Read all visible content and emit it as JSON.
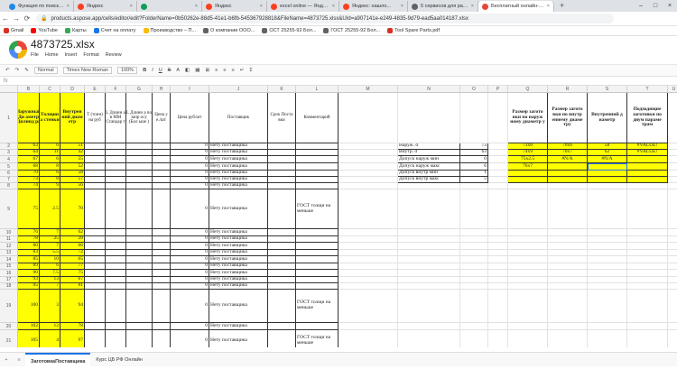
{
  "browser": {
    "tabs": [
      {
        "title": "Функция по поиску ближайш...",
        "color": "#1e88e5"
      },
      {
        "title": "Яндекс",
        "color": "#fc3f1d"
      },
      {
        "title": "",
        "color": "#0f9d58"
      },
      {
        "title": "Яндекс",
        "color": "#fc3f1d"
      },
      {
        "title": "excel online — Яндекс: нашло...",
        "color": "#fc3f1d"
      },
      {
        "title": "Яндекс: нашло...",
        "color": "#fc3f1d"
      },
      {
        "title": "5 сервисов для работы с табли...",
        "color": "#5f6368"
      },
      {
        "title": "Бесплатный онлайн-редактор ...",
        "color": "#e8463b"
      }
    ],
    "close_glyph": "×",
    "new_tab_glyph": "+",
    "window_controls": [
      "–",
      "□",
      "×"
    ],
    "nav": [
      "←",
      "→",
      "⟳"
    ],
    "url": "products.aspose.app/cells/editor/edit?FolderName=0b50262e-88d5-41e1-b6fb-545367928818&FileName=4873725.xlsx&UId=a907141e-e249-4835-9d79-ead5aa014187.xlsx",
    "lock_glyph": "🔒",
    "bookmarks": [
      {
        "label": "Gmail",
        "color": "#d93025"
      },
      {
        "label": "YouTube",
        "color": "#ff0000"
      },
      {
        "label": "Карты",
        "color": "#34a853"
      },
      {
        "label": "Счет на оплату",
        "color": "#1a73e8"
      },
      {
        "label": "Производство – П...",
        "color": "#fbbc04"
      },
      {
        "label": "О компании ООО...",
        "color": "#5f6368"
      },
      {
        "label": "ОСТ 25255-92 Бол...",
        "color": "#5f6368"
      },
      {
        "label": "ГОСТ 25255-92 Бол...",
        "color": "#5f6368"
      },
      {
        "label": "Tool Spare Parts.pdf",
        "color": "#d93025"
      }
    ]
  },
  "app": {
    "file_name": "4873725.xlsx",
    "menus": [
      "File",
      "Home",
      "Insert",
      "Format",
      "Review"
    ],
    "toolbar": {
      "style": "Normal",
      "font": "Times New Roman",
      "zoom": "100%"
    }
  },
  "sheet": {
    "columns": [
      "B",
      "C",
      "D",
      "E",
      "F",
      "G",
      "H",
      "I",
      "J",
      "K",
      "L",
      "M",
      "N",
      "O",
      "P",
      "Q",
      "R",
      "S",
      "T",
      "U"
    ],
    "headers": {
      "B": "Наружный Ди аметр Цилинд ра",
      "C": "Толщин а стенки",
      "D": "Внутрен ний диам етр",
      "E": "Т (тонн) на руб",
      "F": "L Длинн а в ММ Стандар т",
      "G": "L Длинн а по запр осу (Бол ьше )",
      "H": "Цена у е./шт",
      "I": "Цена руб/шт",
      "J": "Поставщик",
      "K": "Срок Поста вки",
      "L": "Комментарий",
      "Q": "Размер загото вки по наруж ному диаметр у",
      "R": "Размер загото вки по внутр еннему диаме тру",
      "S": "Внутренний д иаметр",
      "T": "Подходящие заготовки по двум параме трам"
    },
    "rows": [
      {
        "n": "1"
      },
      {
        "n": "2",
        "B": "63",
        "C": "6",
        "D": "51",
        "I": "0",
        "J": "Нету поставщика"
      },
      {
        "n": "3",
        "B": "64",
        "C": "11",
        "D": "42",
        "I": "0",
        "J": "Нету поставщика"
      },
      {
        "n": "4",
        "B": "67",
        "C": "6",
        "D": "55",
        "I": "0",
        "J": "Нету поставщика"
      },
      {
        "n": "5",
        "B": "68",
        "C": "8",
        "D": "52",
        "I": "0",
        "J": "Нету поставщика"
      },
      {
        "n": "6",
        "B": "70",
        "C": "6",
        "D": "58",
        "I": "0",
        "J": "Нету поставщика"
      },
      {
        "n": "7",
        "B": "73",
        "C": "8",
        "D": "57",
        "I": "0",
        "J": "Нету поставщика"
      },
      {
        "n": "8",
        "B": "74",
        "C": "9",
        "D": "56",
        "I": "0",
        "J": "Нету поставщика"
      },
      {
        "n": "9",
        "B": "75",
        "C": "2.5",
        "D": "70",
        "I": "0",
        "J": "Нету поставщика",
        "L": "ГОСТ толщи на меньше"
      },
      {
        "n": "10",
        "B": "76",
        "C": "7",
        "D": "62",
        "I": "0",
        "J": "Нету поставщика"
      },
      {
        "n": "11",
        "B": "78",
        "C": "25",
        "D": "28",
        "I": "0",
        "J": "Нету поставщика"
      },
      {
        "n": "12",
        "B": "80",
        "C": "7",
        "D": "66",
        "I": "0",
        "J": "Нету поставщика"
      },
      {
        "n": "13",
        "B": "83",
        "C": "5.5",
        "D": "72",
        "I": "0",
        "J": "Нету поставщика"
      },
      {
        "n": "14",
        "B": "85",
        "C": "10",
        "D": "65",
        "I": "0",
        "J": "Нету поставщика"
      },
      {
        "n": "15",
        "B": "89",
        "C": "6",
        "D": "77",
        "I": "0",
        "J": "Нету поставщика"
      },
      {
        "n": "16",
        "B": "90",
        "C": "7.5",
        "D": "75",
        "I": "0",
        "J": "Нету поставщика"
      },
      {
        "n": "17",
        "B": "93",
        "C": "13",
        "D": "67",
        "I": "0",
        "J": "Нету поставщика"
      },
      {
        "n": "18",
        "B": "95",
        "C": "7",
        "D": "81",
        "I": "0",
        "J": "Нету поставщика"
      },
      {
        "n": "19",
        "B": "100",
        "C": "3",
        "D": "94",
        "I": "0",
        "J": "Нету поставщика",
        "L": "ГОСТ толщи на меньше"
      },
      {
        "n": "20",
        "B": "102",
        "C": "12",
        "D": "78",
        "I": "0",
        "J": "Нету поставщика"
      },
      {
        "n": "21",
        "B": "105",
        "C": "4",
        "D": "97",
        "I": "0",
        "J": "Нету поставщика",
        "L": "ГОСТ толщи на меньше"
      },
      {
        "n": "22",
        "B": "108",
        "C": "5",
        "D": "98",
        "I": "0",
        "J": "Нету поставщика"
      },
      {
        "n": "23",
        "B": "110",
        "C": "20",
        "D": "70",
        "I": "0",
        "J": "Нету поставщика"
      },
      {
        "n": "24"
      }
    ],
    "side_table": [
      {
        "label": "Наруж. d",
        "value": "73"
      },
      {
        "label": "Внутр. d",
        "value": "63"
      },
      {
        "label": "Допуск наруж мин",
        "value": "0"
      },
      {
        "label": "Допуск наруж макс",
        "value": "6"
      },
      {
        "label": "Допуск внутр мин",
        "value": "1"
      },
      {
        "label": "Допуск внутр макс",
        "value": "5"
      }
    ],
    "result_rows": [
      {
        "Q": "73х8",
        "R": "70х6",
        "S": "58",
        "T": "#VALUE!"
      },
      {
        "Q": "74х9",
        "R": "76х7",
        "S": "62",
        "T": "#VALUE!"
      },
      {
        "Q": "75х2.5",
        "R": "#N/A",
        "S": "#N/A",
        "T": ""
      },
      {
        "Q": "76х7",
        "R": "",
        "S": "",
        "T": ""
      },
      {
        "Q": "",
        "R": "",
        "S": "",
        "T": ""
      },
      {
        "Q": "",
        "R": "",
        "S": "",
        "T": ""
      }
    ]
  },
  "sheet_tabs": [
    "ЗаготовкаПоставщика",
    "Курс ЦБ РФ Онлайн"
  ]
}
